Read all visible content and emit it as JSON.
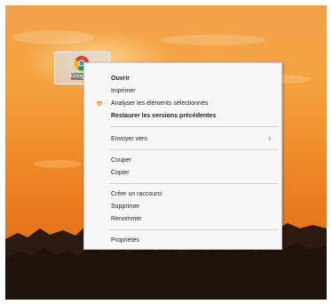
{
  "desktop": {
    "icon_label": "Google Chrome",
    "icon_name": "chrome-icon"
  },
  "context_menu": {
    "items": [
      {
        "label": "Ouvrir"
      },
      {
        "label": "Imprimer"
      },
      {
        "label": "Analyser les éléments sélectionnés",
        "icon": "shield-icon"
      },
      {
        "label": "Restaurer les versions précédentes"
      },
      {
        "label": "Envoyer vers",
        "submenu_icon": "chevron-right-icon"
      },
      {
        "label": "Couper"
      },
      {
        "label": "Copier"
      },
      {
        "label": "Créer un raccourci"
      },
      {
        "label": "Supprimer"
      },
      {
        "label": "Renommer"
      },
      {
        "label": "Propriétés"
      }
    ]
  },
  "colors": {
    "sky_top": "#f2a24c",
    "sky_bottom": "#d66612",
    "treeline": "#2c1a10",
    "menu_background": "#f7f7f7",
    "selection_highlight": "#d6e0ee"
  }
}
